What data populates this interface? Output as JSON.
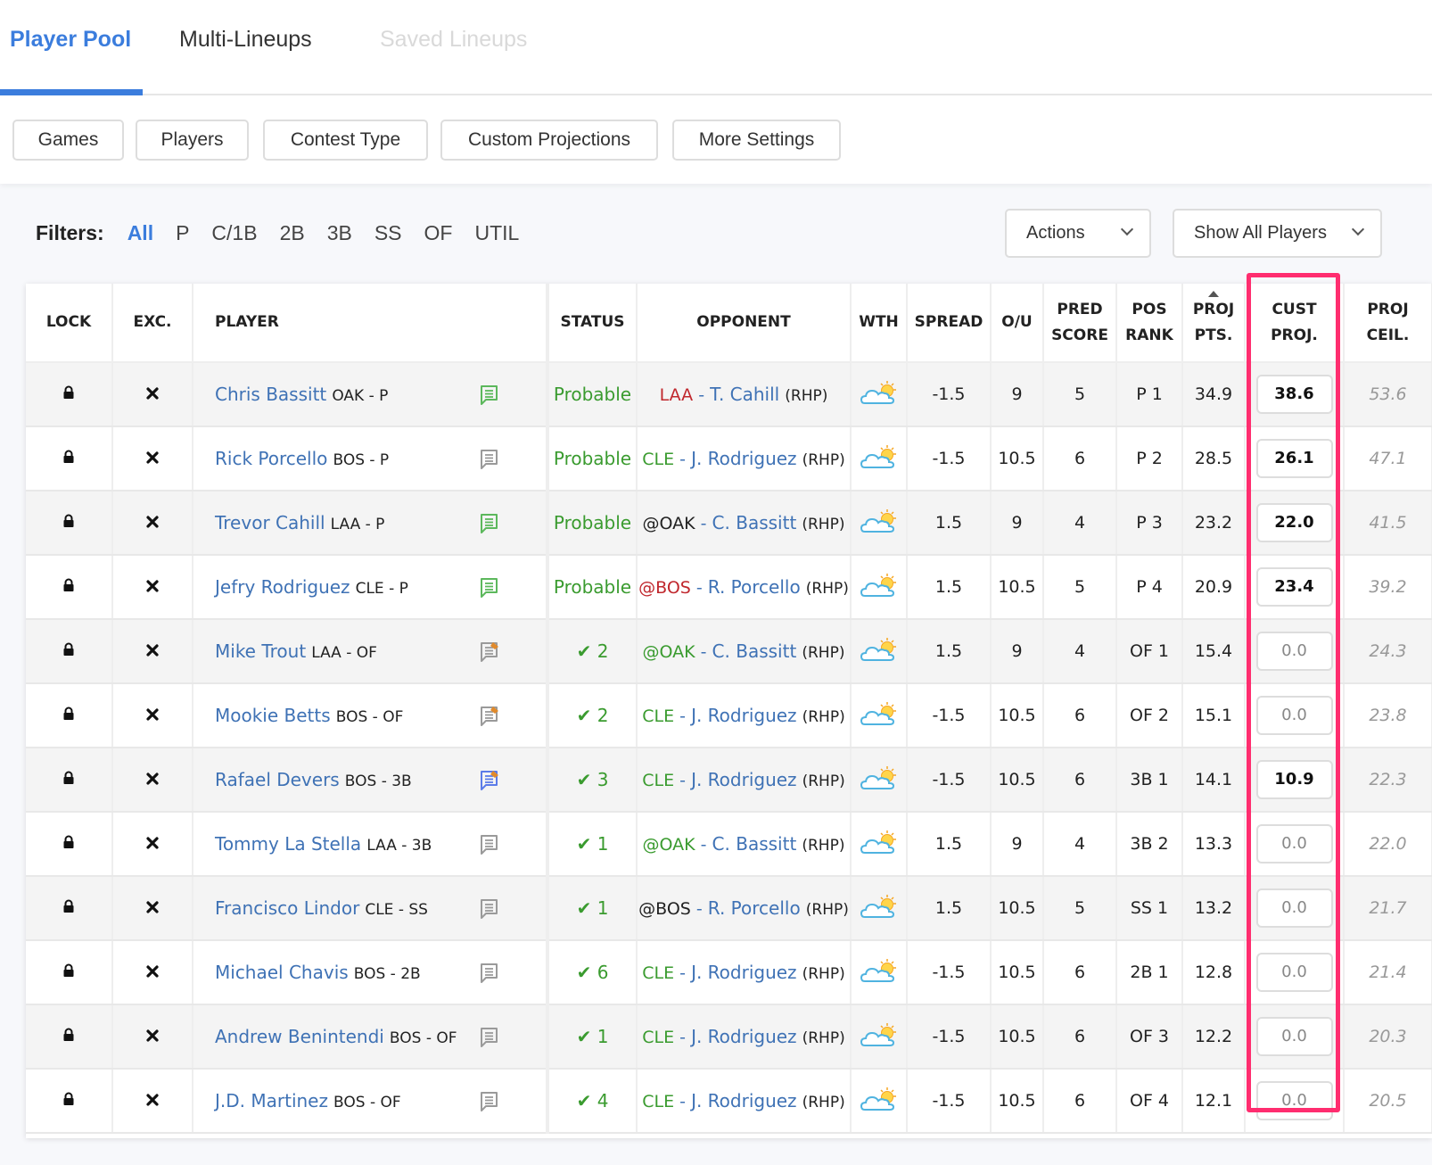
{
  "tabs": [
    {
      "label": "Player Pool",
      "state": "active"
    },
    {
      "label": "Multi-Lineups",
      "state": "normal"
    },
    {
      "label": "Saved Lineups",
      "state": "disabled"
    }
  ],
  "toolbar": {
    "buttons": [
      "Games",
      "Players",
      "Contest Type",
      "Custom Projections",
      "More Settings"
    ]
  },
  "filters": {
    "label": "Filters:",
    "items": [
      "All",
      "P",
      "C/1B",
      "2B",
      "3B",
      "SS",
      "OF",
      "UTIL"
    ],
    "active": "All"
  },
  "actions_dropdown": {
    "label": "Actions"
  },
  "show_dropdown": {
    "label": "Show All Players"
  },
  "colors": {
    "accent": "#3b7ddd",
    "highlight": "#ff2d6f",
    "status_green": "#3a9b2f",
    "team_red": "#c0272d",
    "player_blue": "#3f72b5"
  },
  "table": {
    "headers": {
      "lock": "LOCK",
      "exc": "EXC.",
      "player": "PLAYER",
      "status": "STATUS",
      "opponent": "OPPONENT",
      "wth": "WTH",
      "spread": "SPREAD",
      "ou": "O/U",
      "pred_score": [
        "PRED",
        "SCORE"
      ],
      "pos_rank": [
        "POS",
        "RANK"
      ],
      "proj_pts": [
        "PROJ",
        "PTS."
      ],
      "cust_proj": [
        "CUST",
        "PROJ."
      ],
      "proj_ceil": [
        "PROJ",
        "CEIL."
      ]
    },
    "sorted_by": "proj_pts",
    "rows": [
      {
        "name": "Chris Bassitt",
        "meta": "OAK - P",
        "note": "green",
        "status": "Probable",
        "status_type": "probable",
        "opp_team": "LAA",
        "opp_team_color": "red",
        "opp_pitcher": "T. Cahill",
        "opp_hand": "(RHP)",
        "weather": "partly-cloudy",
        "spread": "-1.5",
        "ou": "9",
        "pred_score": "5",
        "pos_rank": "P 1",
        "proj_pts": "34.9",
        "cust_proj": "38.6",
        "proj_ceil": "53.6"
      },
      {
        "name": "Rick Porcello",
        "meta": "BOS - P",
        "note": "gray",
        "status": "Probable",
        "status_type": "probable",
        "opp_team": "CLE",
        "opp_team_color": "green",
        "opp_pitcher": "J. Rodriguez",
        "opp_hand": "(RHP)",
        "weather": "partly-cloudy",
        "spread": "-1.5",
        "ou": "10.5",
        "pred_score": "6",
        "pos_rank": "P 2",
        "proj_pts": "28.5",
        "cust_proj": "26.1",
        "proj_ceil": "47.1"
      },
      {
        "name": "Trevor Cahill",
        "meta": "LAA - P",
        "note": "green",
        "status": "Probable",
        "status_type": "probable",
        "opp_team": "@OAK",
        "opp_team_color": "black",
        "opp_pitcher": "C. Bassitt",
        "opp_hand": "(RHP)",
        "weather": "partly-cloudy",
        "spread": "1.5",
        "ou": "9",
        "pred_score": "4",
        "pos_rank": "P 3",
        "proj_pts": "23.2",
        "cust_proj": "22.0",
        "proj_ceil": "41.5"
      },
      {
        "name": "Jefry Rodriguez",
        "meta": "CLE - P",
        "note": "green",
        "status": "Probable",
        "status_type": "probable",
        "opp_team": "@BOS",
        "opp_team_color": "red",
        "opp_pitcher": "R. Porcello",
        "opp_hand": "(RHP)",
        "weather": "partly-cloudy",
        "spread": "1.5",
        "ou": "10.5",
        "pred_score": "5",
        "pos_rank": "P 4",
        "proj_pts": "20.9",
        "cust_proj": "23.4",
        "proj_ceil": "39.2"
      },
      {
        "name": "Mike Trout",
        "meta": "LAA - OF",
        "note": "gray-edit",
        "status": "2",
        "status_type": "check",
        "opp_team": "@OAK",
        "opp_team_color": "green",
        "opp_pitcher": "C. Bassitt",
        "opp_hand": "(RHP)",
        "weather": "partly-cloudy",
        "spread": "1.5",
        "ou": "9",
        "pred_score": "4",
        "pos_rank": "OF 1",
        "proj_pts": "15.4",
        "cust_proj": "0.0",
        "proj_ceil": "24.3"
      },
      {
        "name": "Mookie Betts",
        "meta": "BOS - OF",
        "note": "gray-edit",
        "status": "2",
        "status_type": "check",
        "opp_team": "CLE",
        "opp_team_color": "green",
        "opp_pitcher": "J. Rodriguez",
        "opp_hand": "(RHP)",
        "weather": "partly-cloudy",
        "spread": "-1.5",
        "ou": "10.5",
        "pred_score": "6",
        "pos_rank": "OF 2",
        "proj_pts": "15.1",
        "cust_proj": "0.0",
        "proj_ceil": "23.8"
      },
      {
        "name": "Rafael Devers",
        "meta": "BOS - 3B",
        "note": "blue-edit",
        "status": "3",
        "status_type": "check",
        "opp_team": "CLE",
        "opp_team_color": "green",
        "opp_pitcher": "J. Rodriguez",
        "opp_hand": "(RHP)",
        "weather": "partly-cloudy",
        "spread": "-1.5",
        "ou": "10.5",
        "pred_score": "6",
        "pos_rank": "3B 1",
        "proj_pts": "14.1",
        "cust_proj": "10.9",
        "proj_ceil": "22.3"
      },
      {
        "name": "Tommy La Stella",
        "meta": "LAA - 3B",
        "note": "gray",
        "status": "1",
        "status_type": "check",
        "opp_team": "@OAK",
        "opp_team_color": "green",
        "opp_pitcher": "C. Bassitt",
        "opp_hand": "(RHP)",
        "weather": "partly-cloudy",
        "spread": "1.5",
        "ou": "9",
        "pred_score": "4",
        "pos_rank": "3B 2",
        "proj_pts": "13.3",
        "cust_proj": "0.0",
        "proj_ceil": "22.0"
      },
      {
        "name": "Francisco Lindor",
        "meta": "CLE - SS",
        "note": "gray",
        "status": "1",
        "status_type": "check",
        "opp_team": "@BOS",
        "opp_team_color": "black",
        "opp_pitcher": "R. Porcello",
        "opp_hand": "(RHP)",
        "weather": "partly-cloudy",
        "spread": "1.5",
        "ou": "10.5",
        "pred_score": "5",
        "pos_rank": "SS 1",
        "proj_pts": "13.2",
        "cust_proj": "0.0",
        "proj_ceil": "21.7"
      },
      {
        "name": "Michael Chavis",
        "meta": "BOS - 2B",
        "note": "gray",
        "status": "6",
        "status_type": "check",
        "opp_team": "CLE",
        "opp_team_color": "green",
        "opp_pitcher": "J. Rodriguez",
        "opp_hand": "(RHP)",
        "weather": "partly-cloudy",
        "spread": "-1.5",
        "ou": "10.5",
        "pred_score": "6",
        "pos_rank": "2B 1",
        "proj_pts": "12.8",
        "cust_proj": "0.0",
        "proj_ceil": "21.4"
      },
      {
        "name": "Andrew Benintendi",
        "meta": "BOS - OF",
        "note": "gray",
        "status": "1",
        "status_type": "check",
        "opp_team": "CLE",
        "opp_team_color": "green",
        "opp_pitcher": "J. Rodriguez",
        "opp_hand": "(RHP)",
        "weather": "partly-cloudy",
        "spread": "-1.5",
        "ou": "10.5",
        "pred_score": "6",
        "pos_rank": "OF 3",
        "proj_pts": "12.2",
        "cust_proj": "0.0",
        "proj_ceil": "20.3"
      },
      {
        "name": "J.D. Martinez",
        "meta": "BOS - OF",
        "note": "gray",
        "status": "4",
        "status_type": "check",
        "opp_team": "CLE",
        "opp_team_color": "green",
        "opp_pitcher": "J. Rodriguez",
        "opp_hand": "(RHP)",
        "weather": "partly-cloudy",
        "spread": "-1.5",
        "ou": "10.5",
        "pred_score": "6",
        "pos_rank": "OF 4",
        "proj_pts": "12.1",
        "cust_proj": "0.0",
        "proj_ceil": "20.5"
      }
    ]
  }
}
